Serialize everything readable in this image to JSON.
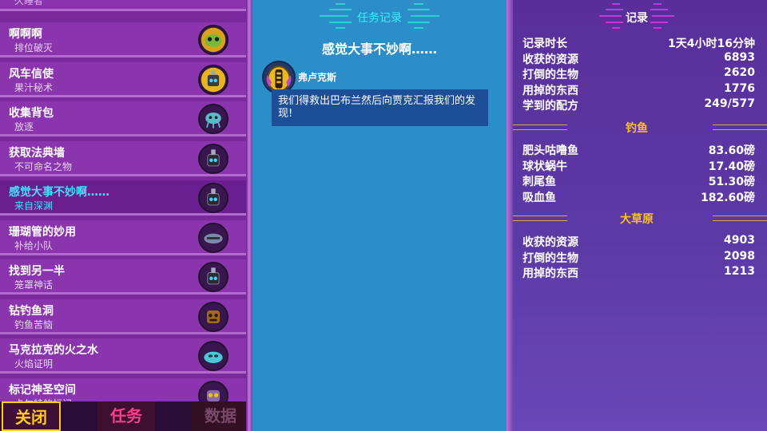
{
  "quests": {
    "partial_title": "久睡者",
    "items": [
      {
        "title": "啊啊啊",
        "subtitle": "排位破灭",
        "icon": "alien-blob-icon",
        "selected": false
      },
      {
        "title": "风车信使",
        "subtitle": "果汁秘术",
        "icon": "robot-yellow-icon",
        "selected": false
      },
      {
        "title": "收集背包",
        "subtitle": "放逐",
        "icon": "alien-squid-icon",
        "selected": false
      },
      {
        "title": "获取法典墙",
        "subtitle": "不可命名之物",
        "icon": "robot-head-icon",
        "selected": false
      },
      {
        "title": "感觉大事不妙啊……",
        "subtitle": "来自深渊",
        "icon": "robot-head-icon",
        "selected": true
      },
      {
        "title": "珊瑚管的妙用",
        "subtitle": "补给小队",
        "icon": "bird-creature-icon",
        "selected": false
      },
      {
        "title": "找到另一半",
        "subtitle": "笼罩神话",
        "icon": "robot-head-icon",
        "selected": false
      },
      {
        "title": "钻钓鱼洞",
        "subtitle": "钓鱼苦恼",
        "icon": "tiki-mask-icon",
        "selected": false
      },
      {
        "title": "马克拉克的火之水",
        "subtitle": "火焰证明",
        "icon": "cyan-blob-icon",
        "selected": false
      },
      {
        "title": "标记神圣空间",
        "subtitle": "卡尔特的标记",
        "icon": "owl-mask-icon",
        "selected": false
      }
    ]
  },
  "bottom_tabs": {
    "close": "关闭",
    "quests": "任务",
    "data": "数据"
  },
  "quest_log": {
    "header": "任务记录",
    "quest_title": "感觉大事不妙啊……",
    "npc_name": "弗卢克斯",
    "npc_icon": "golden-knight-icon",
    "dialog": "我们得救出巴布兰然后向贾克汇报我们的发现!"
  },
  "records": {
    "header": "记录",
    "general": [
      {
        "label": "记录时长",
        "value": "1天4小时16分钟"
      },
      {
        "label": "收获的资源",
        "value": "6893"
      },
      {
        "label": "打倒的生物",
        "value": "2620"
      },
      {
        "label": "用掉的东西",
        "value": "1776"
      },
      {
        "label": "学到的配方",
        "value": "249/577"
      }
    ],
    "fishing_header": "钓鱼",
    "fishing": [
      {
        "label": "肥头咕噜鱼",
        "value": "83.60磅"
      },
      {
        "label": "球状蜗牛",
        "value": "17.40磅"
      },
      {
        "label": "刺尾鱼",
        "value": "51.30磅"
      },
      {
        "label": "吸血鱼",
        "value": "182.60磅"
      }
    ],
    "savanna_header": "大草原",
    "savanna": [
      {
        "label": "收获的资源",
        "value": "4903"
      },
      {
        "label": "打倒的生物",
        "value": "2098"
      },
      {
        "label": "用掉的东西",
        "value": "1213"
      }
    ]
  },
  "colors": {
    "selected_text": "#3fe3ff",
    "section_header": "#ffc21a",
    "close_tab": "#ffcc1a",
    "quests_tab": "#ff3d8c"
  }
}
